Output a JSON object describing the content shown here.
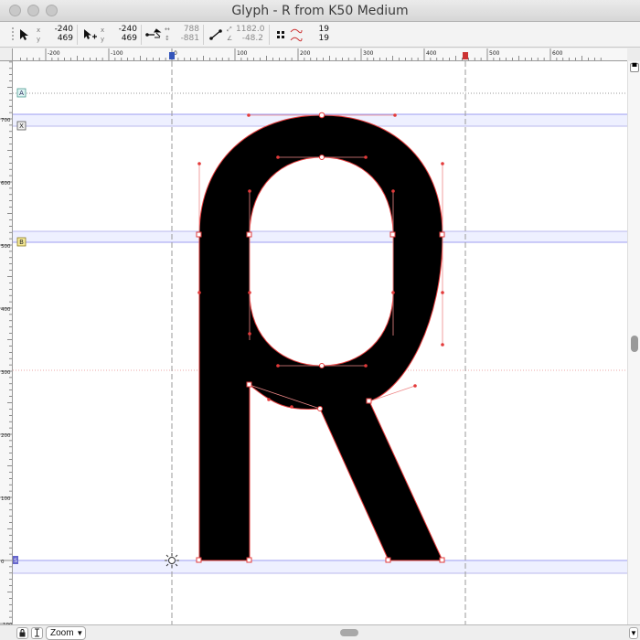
{
  "window": {
    "title": "Glyph - R from K50 Medium"
  },
  "infobar": {
    "cursor_x_label": "x",
    "cursor_y_label": "y",
    "cursor_x": "-240",
    "cursor_y": "469",
    "point_x": "-240",
    "point_y": "469",
    "width_label": "↔",
    "height_label": "↕",
    "width": "788",
    "height": "-881",
    "distance_label": "⤢",
    "angle_label": "∠",
    "distance": "1182.0",
    "angle": "-48.2",
    "nodes_top": "19",
    "nodes_bottom": "19"
  },
  "hruler": {
    "labels": [
      "-200",
      "-100",
      "0",
      "100",
      "200",
      "300",
      "400",
      "500",
      "600"
    ]
  },
  "vruler": {
    "labels": [
      "700",
      "600",
      "500",
      "400",
      "300",
      "200",
      "100",
      "0",
      "-100"
    ]
  },
  "guides": {
    "markers": [
      "A",
      "X",
      "B",
      "S"
    ]
  },
  "bottombar": {
    "zoom_label": "Zoom"
  },
  "colors": {
    "glyph_fill": "#000000",
    "outline": "#e33a3a",
    "node": "#e33a3a",
    "metric_line": "#9c9cf0",
    "metric_band": "#eef0ff",
    "metric_band_border": "#b9b9ee",
    "dotted_guide": "#e88a8a",
    "dashed_guide": "#9a9a9a"
  }
}
